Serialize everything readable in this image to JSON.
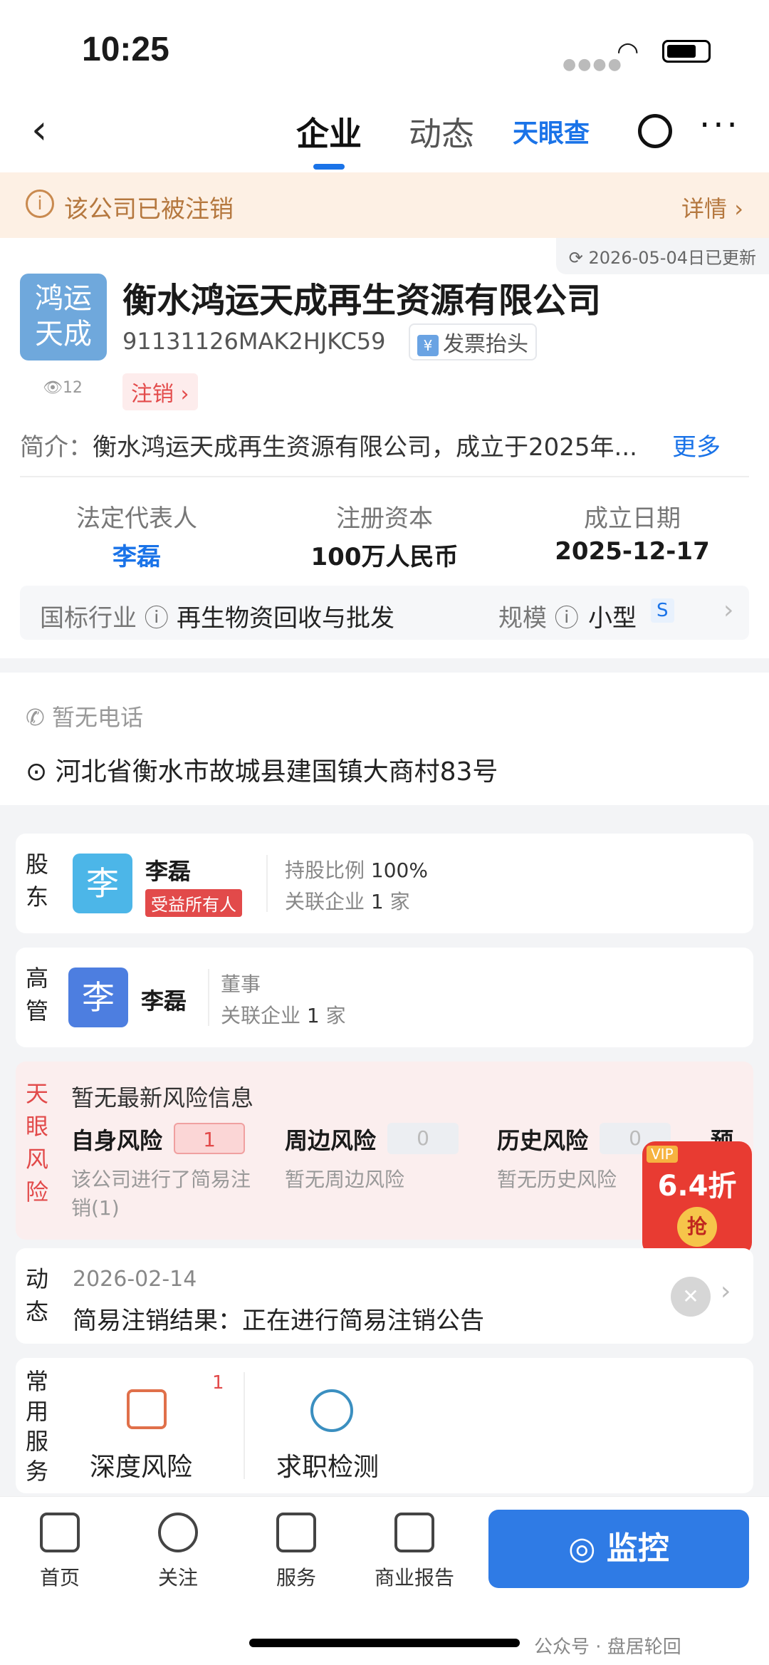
{
  "status": {
    "time": "10:25"
  },
  "nav": {
    "tabs": [
      "企业",
      "动态"
    ],
    "brand": "天眼查"
  },
  "banner": {
    "text": "该公司已被注销",
    "detail": "详情"
  },
  "company": {
    "update": "2026-05-04日已更新",
    "logo_line1": "鸿运",
    "logo_line2": "天成",
    "views": "12",
    "name": "衡水鸿运天成再生资源有限公司",
    "credit_code": "91131126MAK2HJKC59",
    "invoice": "发票抬头",
    "status": "注销",
    "intro_label": "简介：",
    "intro": "衡水鸿运天成再生资源有限公司，成立于2025年...",
    "more": "更多",
    "legal_rep_label": "法定代表人",
    "legal_rep": "李磊",
    "capital_label": "注册资本",
    "capital": "100万人民币",
    "date_label": "成立日期",
    "date": "2025-12-17",
    "industry_label": "国标行业",
    "industry": "再生物资回收与批发",
    "scale_label": "规模",
    "scale": "小型",
    "scale_badge": "S"
  },
  "contact": {
    "phone": "暂无电话",
    "address": "河北省衡水市故城县建国镇大商村83号"
  },
  "shareholder": {
    "label": "股东",
    "avatar": "李",
    "name": "李磊",
    "tag": "受益所有人",
    "ratio_label": "持股比例",
    "ratio": "100%",
    "rel_label": "关联企业",
    "rel_count": "1",
    "rel_unit": "家"
  },
  "executive": {
    "label": "高管",
    "avatar": "李",
    "name": "李磊",
    "role": "董事",
    "rel_label": "关联企业",
    "rel_count": "1",
    "rel_unit": "家"
  },
  "risk": {
    "label": "天眼风险",
    "title": "暂无最新风险信息",
    "self": "自身风险",
    "self_count": "1",
    "self_desc": "该公司进行了简易注销(1)",
    "around": "周边风险",
    "around_count": "0",
    "around_desc": "暂无周边风险",
    "history": "历史风险",
    "history_count": "0",
    "history_desc": "暂无历史风险",
    "warn": "预警"
  },
  "vip": {
    "tag": "VIP",
    "discount": "6.4折",
    "grab": "抢"
  },
  "news": {
    "label": "动态",
    "date": "2026-02-14",
    "title": "简易注销结果：正在进行简易注销公告"
  },
  "services": {
    "label": "常用服务",
    "items": [
      "深度风险",
      "求职检测"
    ],
    "badge": "1"
  },
  "tabbar": {
    "items": [
      "首页",
      "关注",
      "服务",
      "商业报告"
    ],
    "monitor": "监控"
  },
  "watermark": "公众号 · 盘居轮回"
}
